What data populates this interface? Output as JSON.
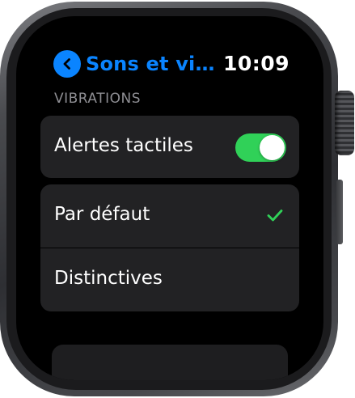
{
  "header": {
    "back_label": "Sons et vi…",
    "back_icon": "chevron-left-icon",
    "time": "10:09"
  },
  "section": {
    "title": "VIBRATIONS"
  },
  "rows": {
    "haptic_alerts": {
      "label": "Alertes tactiles",
      "toggle_on": true
    },
    "default": {
      "label": "Par défaut",
      "selected": true,
      "check_icon": "checkmark-icon"
    },
    "prominent": {
      "label": "Distinctives",
      "selected": false
    }
  },
  "colors": {
    "accent": "#0a84ff",
    "toggle_on": "#30d158",
    "row_background": "#222224",
    "section_text": "#8e8e93"
  }
}
